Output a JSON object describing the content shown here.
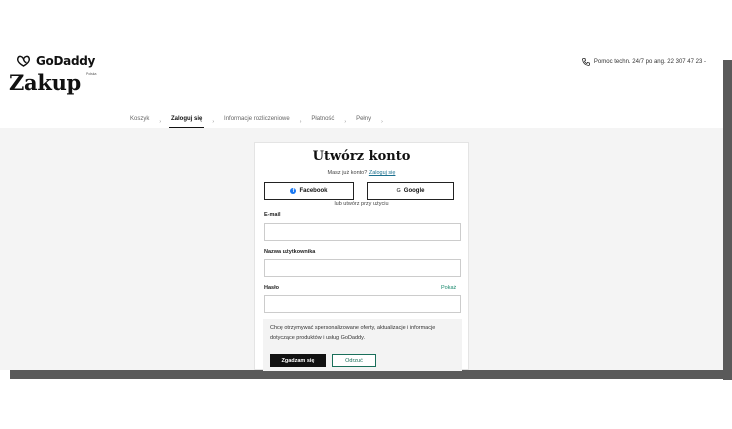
{
  "header": {
    "logo_text": "GoDaddy",
    "tagline": "Polska",
    "page_title": "Zakup",
    "support_text": "Pomoc techn. 24/7 po ang. 22 307 47 23 -"
  },
  "steps": [
    {
      "label": "Koszyk",
      "active": false
    },
    {
      "label": "Zaloguj się",
      "active": true
    },
    {
      "label": "Informacje rozliczeniowe",
      "active": false
    },
    {
      "label": "Płatność",
      "active": false
    },
    {
      "label": "Pełny",
      "active": false
    }
  ],
  "step_separator": "›",
  "form": {
    "title": "Utwórz konto",
    "have_account_text": "Masz już konto?",
    "login_link": "Zaloguj się",
    "facebook_label": "Facebook",
    "google_label": "Google",
    "or_text": "lub utwórz przy użyciu",
    "email_label": "E-mail",
    "email_value": "",
    "username_label": "Nazwa użytkownika",
    "username_value": "",
    "password_label": "Hasło",
    "password_value": "",
    "show_password": "Pokaż",
    "consent_text": "Chcę otrzymywać spersonalizowane oferty, aktualizacje i informacje dotyczące produktów i usług GoDaddy.",
    "agree_label": "Zgadzam się",
    "reject_label": "Odrzuć"
  },
  "colors": {
    "facebook": "#1877f2",
    "link": "#1a6f8e",
    "accent_green": "#1a6f5a",
    "page_gray": "#f4f4f4",
    "frame_bar": "#5a5a5a"
  },
  "icons": {
    "logo": "godaddy-logo-icon",
    "support": "phone-icon",
    "facebook": "facebook-icon",
    "google": "google-icon"
  }
}
